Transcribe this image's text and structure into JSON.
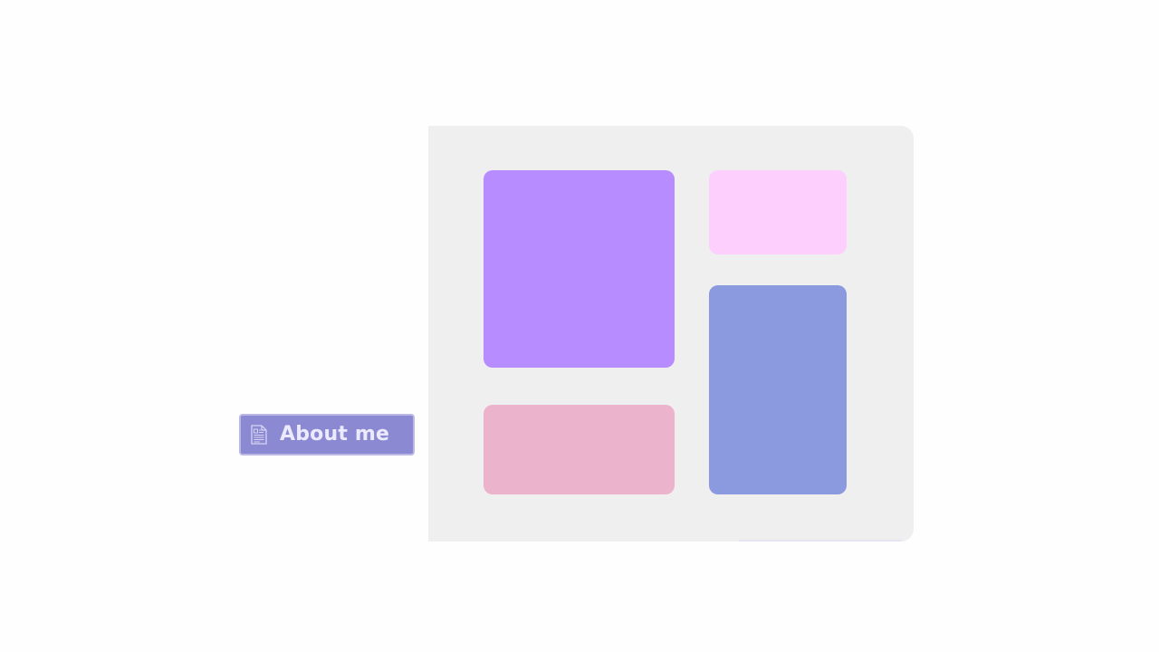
{
  "about_button": {
    "label": "About me",
    "icon": "document-icon"
  },
  "colors": {
    "page_background": "#fefefe",
    "panel_background": "#f0eff0",
    "button_background": "#8b89d1",
    "button_text": "#eceaff",
    "tile_purple": "#b68cfe",
    "tile_pink": "#fccffd",
    "tile_rose": "#ebb4cc",
    "tile_blue": "#8b99df"
  }
}
